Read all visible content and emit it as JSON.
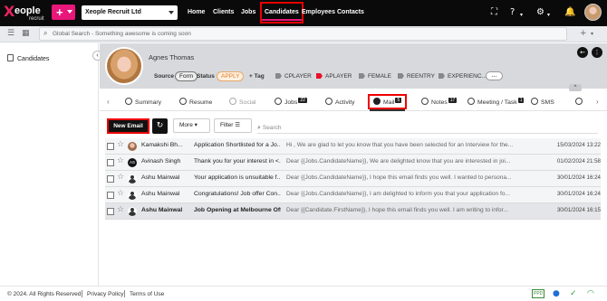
{
  "brand": {
    "logo_mark": "X",
    "logo_word": "eople",
    "logo_sub": "recruit"
  },
  "topnav": {
    "company": "Xeople Recruit Ltd",
    "links": [
      "Home",
      "Clients",
      "Jobs",
      "Candidates",
      "Employees",
      "Contacts"
    ],
    "active": "Candidates",
    "accent_color": "#e8177a"
  },
  "search": {
    "placeholder": "Global Search - Something awesome is coming soon"
  },
  "sidebar": {
    "items": [
      {
        "label": "Candidates"
      }
    ]
  },
  "candidate": {
    "name": "Agnes Thomas",
    "source_label": "Source",
    "source_value": "Form",
    "status_label": "Status",
    "status_value": "APPLY",
    "add_tag": "+ Tag",
    "tags": [
      "CPLAYER",
      "APLAYER",
      "FEMALE",
      "REENTRY",
      "EXPERIENC..."
    ],
    "more": "..."
  },
  "tabs": [
    {
      "label": "Summary",
      "count": ""
    },
    {
      "label": "Resume",
      "count": ""
    },
    {
      "label": "Social",
      "count": ""
    },
    {
      "label": "Jobs",
      "count": "22"
    },
    {
      "label": "Activity",
      "count": ""
    },
    {
      "label": "Mail",
      "count": "5"
    },
    {
      "label": "Notes",
      "count": "17"
    },
    {
      "label": "Meeting / Task",
      "count": "1"
    },
    {
      "label": "SMS",
      "count": ""
    }
  ],
  "active_tab": "Mail",
  "toolbar": {
    "new_email": "New Email",
    "more": "More",
    "filter": "Filter",
    "search_placeholder": "Search"
  },
  "mails": [
    {
      "from": "Kamakshi Bh...",
      "subject": "Application Shortlisted for a Jo...",
      "preview": "Hi , We are glad to let you know that you have been selected for an Interview for the...",
      "date": "15/03/2024 13:22",
      "avatar": "photo",
      "bold": false
    },
    {
      "from": "Avinash Singh",
      "subject": "Thank you for your interest in <...",
      "preview": "Dear {{Jobs.CandidateName}}, We are delighted know that you are interested in joi...",
      "date": "01/02/2024 21:58",
      "avatar": "AS",
      "bold": false
    },
    {
      "from": "Ashu Mainwal",
      "subject": "Your application is unsuitable f...",
      "preview": "Dear {{Jobs.CandidateName}}, I hope this email finds you well. I wanted to persona...",
      "date": "30/01/2024 16:24",
      "avatar": "person",
      "bold": false
    },
    {
      "from": "Ashu Mainwal",
      "subject": "Congratulations! Job offer Con...",
      "preview": "Dear {{Jobs.CandidateName}}, I am delighted to inform you that your application fo...",
      "date": "30/01/2024 16:24",
      "avatar": "person",
      "bold": false
    },
    {
      "from": "Ashu Mainwal",
      "subject": "Job Opening at Melbourne Offi...",
      "preview": "Dear {{Candidate.FirstName}}, I hope this email finds you well. I am writing to infor...",
      "date": "30/01/2024 16:15",
      "avatar": "person",
      "bold": true
    }
  ],
  "footer": {
    "copyright": "© 2024. All Rights Reserved",
    "privacy": "Privacy Policy",
    "terms": "Terms of Use",
    "badge": "PPD"
  }
}
